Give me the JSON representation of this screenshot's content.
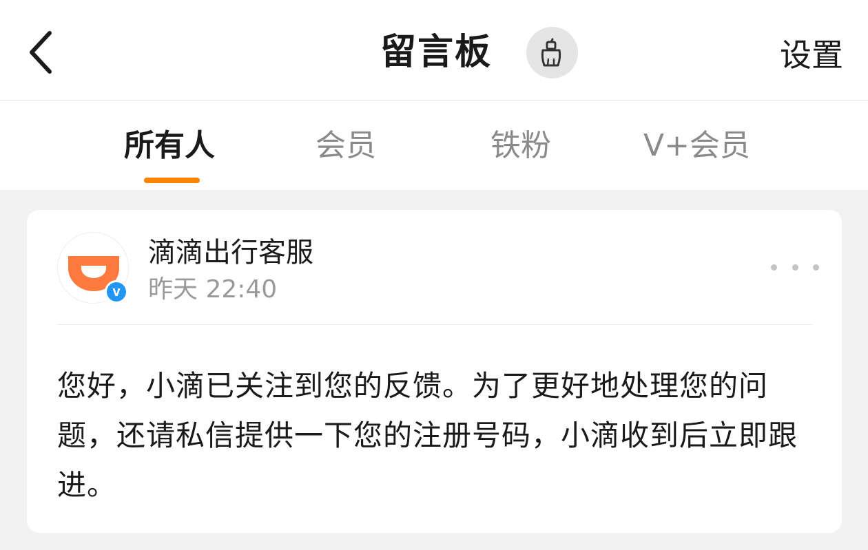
{
  "header": {
    "back_icon": "chevron-left-icon",
    "title": "留言板",
    "clean_icon": "broom-icon",
    "settings_label": "设置"
  },
  "tabs": [
    {
      "label": "所有人",
      "active": true
    },
    {
      "label": "会员",
      "active": false
    },
    {
      "label": "铁粉",
      "active": false
    },
    {
      "label": "V+会员",
      "active": false
    }
  ],
  "colors": {
    "accent": "#ff8200",
    "verified": "#2196f3",
    "logo": "#ff7a3d"
  },
  "message": {
    "author": "滴滴出行客服",
    "verified_badge": "v",
    "time": "昨天 22:40",
    "content": "您好，小滴已关注到您的反馈。为了更好地处理您的问题，还请私信提供一下您的注册号码，小滴收到后立即跟进。"
  }
}
